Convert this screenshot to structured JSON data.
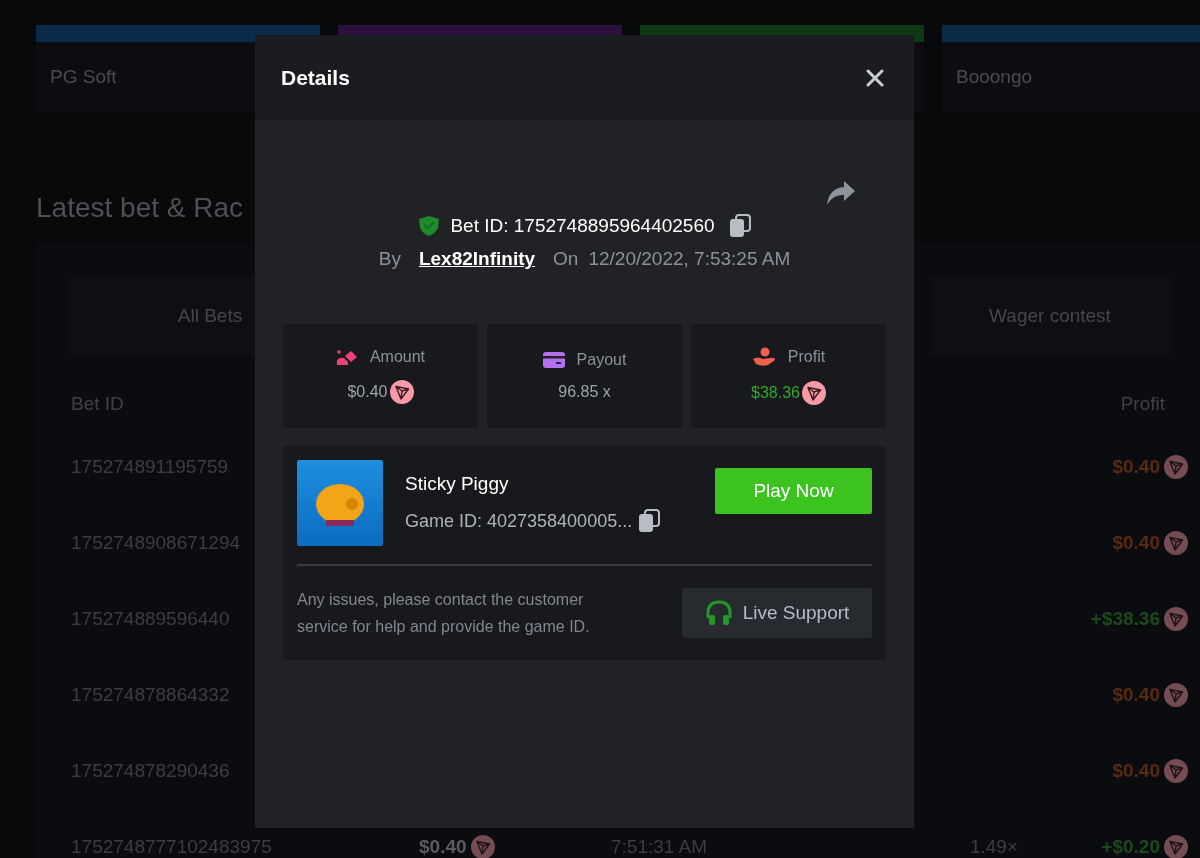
{
  "providers": [
    {
      "label": "PG Soft",
      "color": "#0a2a4a"
    },
    {
      "color": "#2a0f3f"
    },
    {
      "color": "#0d3a12"
    },
    {
      "label": "Booongo",
      "color": "#0a2a45"
    }
  ],
  "section_title": "Latest bet & Rac",
  "tabs": [
    {
      "label": "All Bets"
    },
    {
      "label": "Wager contest"
    }
  ],
  "table": {
    "columns": [
      "Bet ID",
      "Profit"
    ],
    "rows": [
      {
        "bet_id": "175274891195759",
        "profit": "$0.40",
        "color": "#5a2a10"
      },
      {
        "bet_id": "1752748908671294",
        "profit": "$0.40",
        "color": "#5a2a10"
      },
      {
        "bet_id": "175274889596440",
        "profit": "+$38.36",
        "color": "#1c4a1c"
      },
      {
        "bet_id": "175274878864332",
        "profit": "$0.40",
        "color": "#5a2a10"
      },
      {
        "bet_id": "175274878290436",
        "profit": "$0.40",
        "color": "#5a2a10"
      },
      {
        "bet_id": "1752748777102483975",
        "amount": "$0.40",
        "time": "7:51:31 AM",
        "payout": "1.49×",
        "profit": "+$0.20",
        "color": "#1c4a1c"
      }
    ]
  },
  "modal": {
    "title": "Details",
    "bet_id": "Bet ID: 1752748895964402560",
    "by_label": "By",
    "user": "Lex82Infinity",
    "on_label": "On",
    "date": "12/20/2022, 7:53:25 AM",
    "stats": [
      {
        "kind": "amount",
        "label": "Amount",
        "value": "$0.40",
        "coin": true,
        "color": "#9ea3ab"
      },
      {
        "kind": "payout",
        "label": "Payout",
        "value": "96.85 x",
        "coin": false,
        "color": "#9ea3ab"
      },
      {
        "kind": "profit",
        "label": "Profit",
        "value": "$38.36",
        "coin": true,
        "color": "#2fa92a"
      }
    ],
    "game": {
      "name": "Sticky Piggy",
      "game_id": "Game ID: 4027358400005...",
      "play_button": "Play Now",
      "note": "Any issues, please contact the customer service for help and provide the game ID.",
      "support_button": "Live Support"
    }
  }
}
